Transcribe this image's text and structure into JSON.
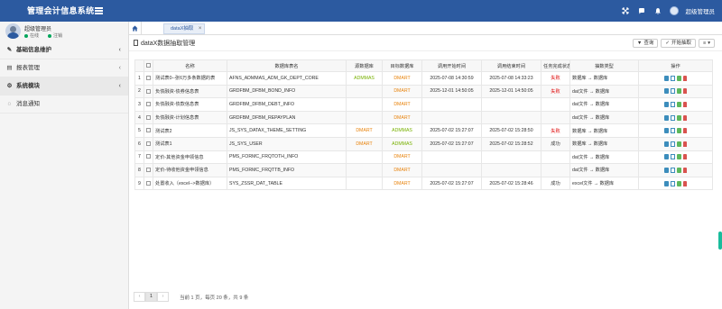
{
  "header": {
    "app_title": "管理会计信息系统",
    "user_label": "超级管理员",
    "icons": [
      "expand-icon",
      "chat-icon",
      "bell-icon"
    ]
  },
  "sidebar": {
    "user": {
      "name": "超级管理员",
      "status_online": "在线",
      "status_role": "注销"
    },
    "items": [
      {
        "label": "基础信息维护",
        "icon": "wrench-icon",
        "expandable": true
      },
      {
        "label": "报表管理",
        "icon": "folder-icon",
        "expandable": true
      },
      {
        "label": "系统模块",
        "icon": "gear-icon",
        "expandable": true
      },
      {
        "label": "消息通知",
        "icon": "bell-icon",
        "expandable": false
      }
    ]
  },
  "tabs": {
    "home_icon": "home-icon",
    "active_tab": "dataX抽取",
    "close_symbol": "×"
  },
  "page": {
    "title": "dataX数据抽取管理",
    "query_button": "查询",
    "start_button": "开始抽取",
    "more_button": "≡"
  },
  "table": {
    "headers": [
      "",
      "",
      "名称",
      "数据库表名",
      "源数据库",
      "目标数据库",
      "调用开始时间",
      "调用结束时间",
      "任务完成状态",
      "抽数类型",
      "操作"
    ],
    "rows": [
      {
        "no": "1",
        "name": "测试表0--张6万多条数据的表",
        "table": "AFNS_ADMMAS_ADM_GK_DEPT_CORE",
        "src": "ADMMAS",
        "dst": "DMART",
        "start": "2025-07-08 14:30:59",
        "end": "2025-07-08 14:33:23",
        "status": "失败",
        "type": "数据库 → 数据库"
      },
      {
        "no": "2",
        "name": "负债融资-债券信息表",
        "table": "GRDFBM_DFBM_BOND_INFO",
        "src": "",
        "dst": "DMART",
        "start": "2025-12-01 14:50:05",
        "end": "2025-12-01 14:50:05",
        "status": "失败",
        "type": "dat文件 → 数据库"
      },
      {
        "no": "3",
        "name": "负债融资-债款信息表",
        "table": "GRDFBM_DFBM_DEBT_INFO",
        "src": "",
        "dst": "DMART",
        "start": "",
        "end": "",
        "status": "",
        "type": "dat文件 → 数据库"
      },
      {
        "no": "4",
        "name": "负债融资-计划信息表",
        "table": "GRDFBM_DFBM_REPAYPLAN",
        "src": "",
        "dst": "DMART",
        "start": "",
        "end": "",
        "status": "",
        "type": "dat文件 → 数据库"
      },
      {
        "no": "5",
        "name": "测试表2",
        "table": "JS_SYS_DATAX_THEME_SETTING",
        "src": "DMART",
        "dst": "ADMMAS",
        "start": "2025-07-02 15:27:07",
        "end": "2025-07-02 15:28:50",
        "status": "失败",
        "type": "数据库 → 数据库"
      },
      {
        "no": "6",
        "name": "测试表1",
        "table": "JS_SYS_USER",
        "src": "DMART",
        "dst": "ADMMAS",
        "start": "2025-07-02 15:27:07",
        "end": "2025-07-02 15:28:52",
        "status": "成功",
        "type": "数据库 → 数据库"
      },
      {
        "no": "7",
        "name": "定价-其他资金申领信息",
        "table": "PMS_FORMC_FRQTOTH_INFO",
        "src": "",
        "dst": "DMART",
        "start": "",
        "end": "",
        "status": "",
        "type": "dat文件 → 数据库"
      },
      {
        "no": "8",
        "name": "定价-待收他资金申领信息",
        "table": "PMS_FORMC_FRQTTB_INFO",
        "src": "",
        "dst": "DMART",
        "start": "",
        "end": "",
        "status": "",
        "type": "dat文件 → 数据库"
      },
      {
        "no": "9",
        "name": "处置收入（excel-->数据库）",
        "table": "SYS_ZSSR_DAT_TABLE",
        "src": "",
        "dst": "DMART",
        "start": "2025-07-02 15:27:07",
        "end": "2025-07-02 15:28:46",
        "status": "成功",
        "type": "excel文件 → 数据库"
      }
    ]
  },
  "pager": {
    "prev": "‹",
    "page": "1",
    "next": "›",
    "info": "当前 1 页，每页 20 条，共 9 条"
  },
  "colors": {
    "header": "#2c5aa0",
    "orange": "#e8830c",
    "green": "#77b000",
    "fail": "#dd0000"
  }
}
